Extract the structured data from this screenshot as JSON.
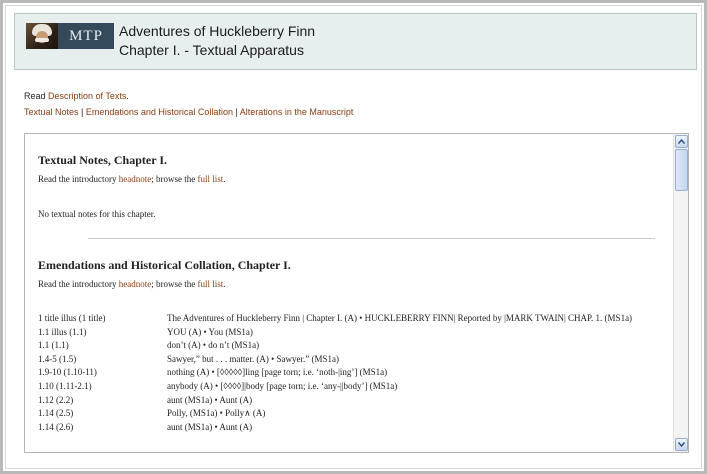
{
  "header": {
    "logo_text": "MTP",
    "title": "Adventures of Huckleberry Finn",
    "subtitle": "Chapter I. - Textual Apparatus"
  },
  "toplinks": {
    "read_prefix": "Read ",
    "description_link": "Description of Texts",
    "read_suffix": ".",
    "nav": [
      "Textual Notes",
      "Emendations and Historical Collation",
      "Alterations in the Manuscript"
    ],
    "separator": " | "
  },
  "textual_notes": {
    "heading": "Textual Notes, Chapter I.",
    "intro_prefix": "Read the introductory ",
    "headnote_link": "headnote",
    "intro_middle": "; browse the ",
    "fulllist_link": "full list",
    "intro_suffix": ".",
    "empty_text": "No textual notes for this chapter."
  },
  "emendations": {
    "heading": "Emendations and Historical Collation, Chapter I.",
    "intro_prefix": "Read the introductory ",
    "headnote_link": "headnote",
    "intro_middle": "; browse the ",
    "fulllist_link": "full list",
    "intro_suffix": ".",
    "rows": [
      {
        "ref": "1 title illus (1 title)",
        "note": "The Adventures of Huckleberry Finn | Chapter I. (A) • HUCKLEBERRY FINN| Reported by |MARK TWAIN| CHAP. 1. (MS1a)"
      },
      {
        "ref": "1.1 illus (1.1)",
        "note": "YOU (A) • You (MS1a)"
      },
      {
        "ref": "1.1 (1.1)",
        "note": "don’t (A) • do n’t (MS1a)"
      },
      {
        "ref": "1.4-5 (1.5)",
        "note": "Sawyer,” but . . . matter. (A) • Sawyer.” (MS1a)"
      },
      {
        "ref": "1.9-10 (1.10-11)",
        "note": "nothing (A) • [◊◊◊◊◊]ling [page torn; i.e. ‘noth-|ing’] (MS1a)"
      },
      {
        "ref": "1.10 (1.11-2.1)",
        "note": "anybody (A) • [◊◊◊◊]|body [page torn; i.e. ‘any-||body’] (MS1a)"
      },
      {
        "ref": "1.12 (2.2)",
        "note": "aunt (MS1a) • Aunt (A)"
      },
      {
        "ref": "1.14 (2.5)",
        "note": "Polly, (MS1a) • Polly∧ (A)"
      },
      {
        "ref": "1.14 (2.6)",
        "note": "aunt (MS1a) • Aunt (A)"
      }
    ]
  },
  "icons": {
    "scroll_up": "chevron-up-icon",
    "scroll_down": "chevron-down-icon"
  }
}
